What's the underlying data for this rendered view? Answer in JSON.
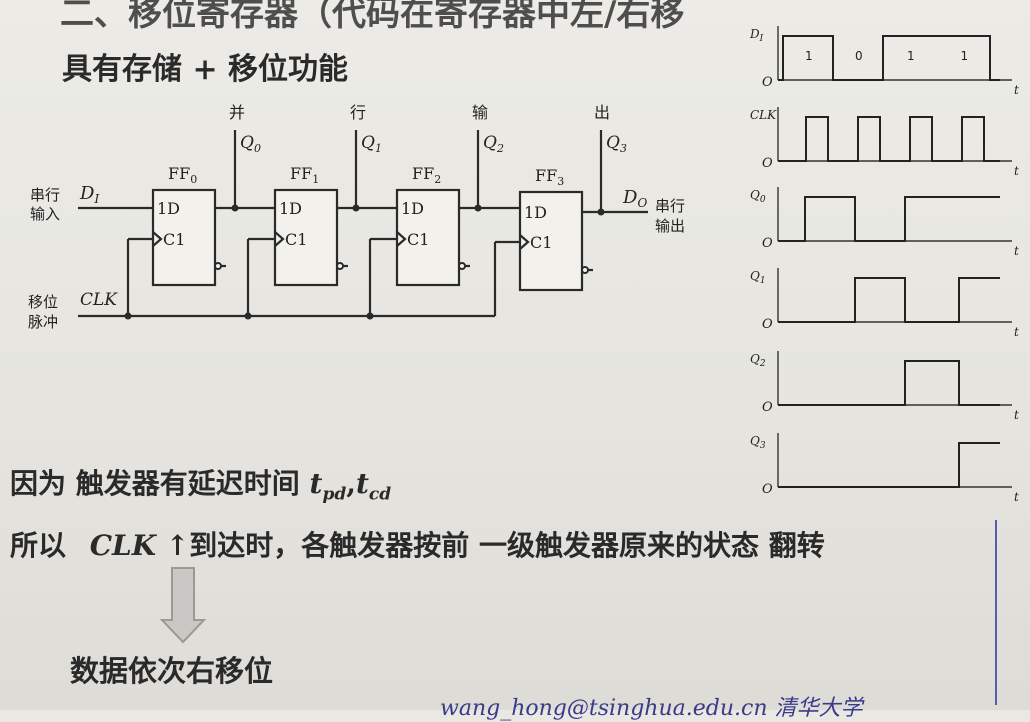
{
  "slide": {
    "title_top": "二、移位寄存器（代码在寄存器中左/右移",
    "subtitle": "具有存储 + 移位功能",
    "because_prefix": "因为  触发器有延迟时间",
    "t_pd": "t",
    "t_pd_sub": "pd",
    "t_cd": "t",
    "t_cd_sub": "cd",
    "so_prefix": "所以",
    "clk_label": "CLK",
    "up_arrow": "↑",
    "so_suffix": "到达时，各触发器按前 一级触发器原来的状态 翻转",
    "conclusion": "数据依次右移位",
    "footer": "wang_hong@tsinghua.edu.cn   清华大学"
  },
  "circuit": {
    "serial_in_label": [
      "串行",
      "输入"
    ],
    "serial_out_label": [
      "串行",
      "输出"
    ],
    "shift_pulse_label": [
      "移位",
      "脉冲"
    ],
    "input_signal": "D",
    "input_signal_sub": "I",
    "output_signal": "D",
    "output_signal_sub": "O",
    "clock_signal": "CLK",
    "parallel_out_chars": [
      "并",
      "行",
      "输",
      "出"
    ],
    "flipflops": [
      {
        "name": "FF",
        "sub": "0",
        "d": "1D",
        "c": "C1",
        "q": "Q",
        "q_sub": "0"
      },
      {
        "name": "FF",
        "sub": "1",
        "d": "1D",
        "c": "C1",
        "q": "Q",
        "q_sub": "1"
      },
      {
        "name": "FF",
        "sub": "2",
        "d": "1D",
        "c": "C1",
        "q": "Q",
        "q_sub": "2"
      },
      {
        "name": "FF",
        "sub": "3",
        "d": "1D",
        "c": "C1",
        "q": "Q",
        "q_sub": "3"
      }
    ]
  },
  "timing": {
    "origin": "O",
    "time_axis": "t",
    "signals": [
      {
        "name": "D",
        "sub": "I",
        "levels": [
          1,
          0,
          1,
          1
        ],
        "bit_labels": [
          "1",
          "0",
          "1",
          "1"
        ]
      },
      {
        "name": "CLK",
        "sub": "",
        "levels": [
          1,
          1,
          1,
          1
        ]
      },
      {
        "name": "Q",
        "sub": "0",
        "levels": [
          1,
          0,
          1,
          1
        ]
      },
      {
        "name": "Q",
        "sub": "1",
        "levels": [
          0,
          1,
          0,
          1
        ]
      },
      {
        "name": "Q",
        "sub": "2",
        "levels": [
          0,
          0,
          1,
          0
        ]
      },
      {
        "name": "Q",
        "sub": "3",
        "levels": [
          0,
          0,
          0,
          1
        ]
      }
    ]
  }
}
